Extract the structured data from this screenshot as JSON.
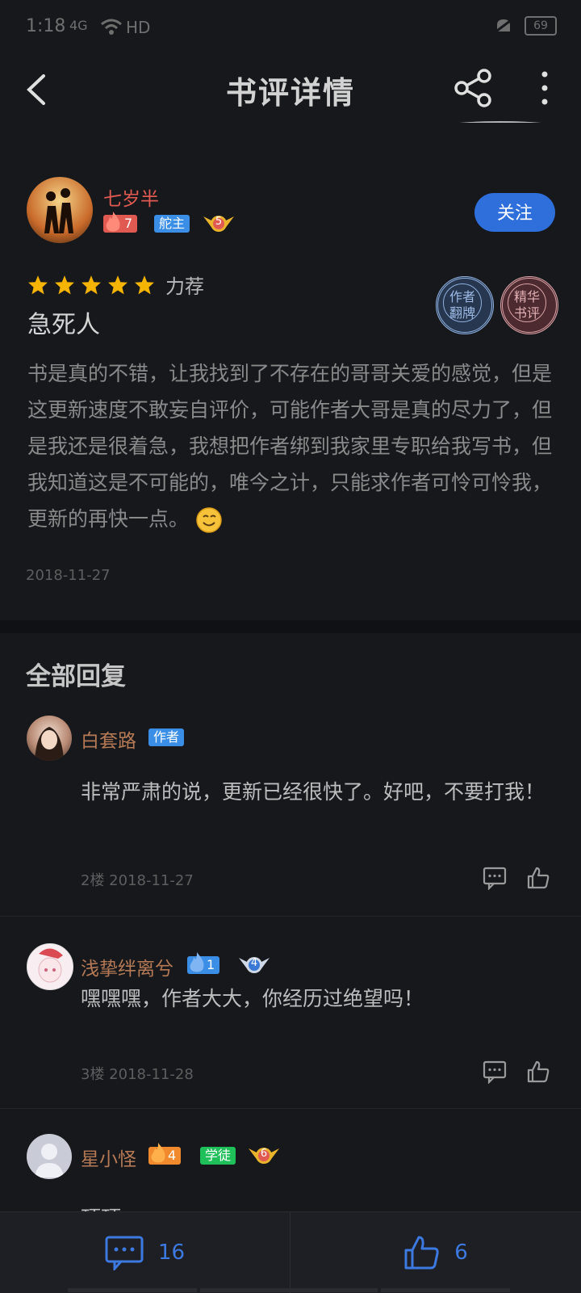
{
  "status_bar": {
    "time": "1:18",
    "network": "4G",
    "hd": "HD",
    "battery": "69"
  },
  "header": {
    "title": "书评详情"
  },
  "review": {
    "username": "七岁半",
    "fire_level": "7",
    "role_badge": "舵主",
    "rank_level": "5",
    "follow_label": "关注",
    "rating_label": "力荐",
    "title": "急死人",
    "seal_author": "作者 翻牌",
    "seal_featured": "精华 书评",
    "body": "书是真的不错，让我找到了不存在的哥哥关爱的感觉，但是这更新速度不敢妄自评价，可能作者大哥是真的尽力了，但是我还是很着急，我想把作者绑到我家里专职给我写书，但我知道这是不可能的，唯今之计，只能求作者可怜可怜我，更新的再快一点。",
    "date": "2018-11-27"
  },
  "replies_section": {
    "title": "全部回复"
  },
  "replies": [
    {
      "username": "白套路",
      "badge": "作者",
      "text": "非常严肃的说，更新已经很快了。好吧，不要打我！",
      "meta": "2楼 2018-11-27"
    },
    {
      "username": "浅挚绊离兮",
      "fire_level": "1",
      "rank_level": "4",
      "text": "嘿嘿嘿，作者大大，你经历过绝望吗！",
      "meta": "3楼 2018-11-28"
    },
    {
      "username": "星小怪",
      "fire_level": "4",
      "badge": "学徒",
      "rank_level": "6",
      "text": "顶顶"
    }
  ],
  "bottom_bar": {
    "comment_count": "16",
    "like_count": "6"
  },
  "colors": {
    "accent": "#2f6fdc",
    "reviewer_name": "#e05a52",
    "reply_name": "#b57a55",
    "star": "#f5b400"
  }
}
